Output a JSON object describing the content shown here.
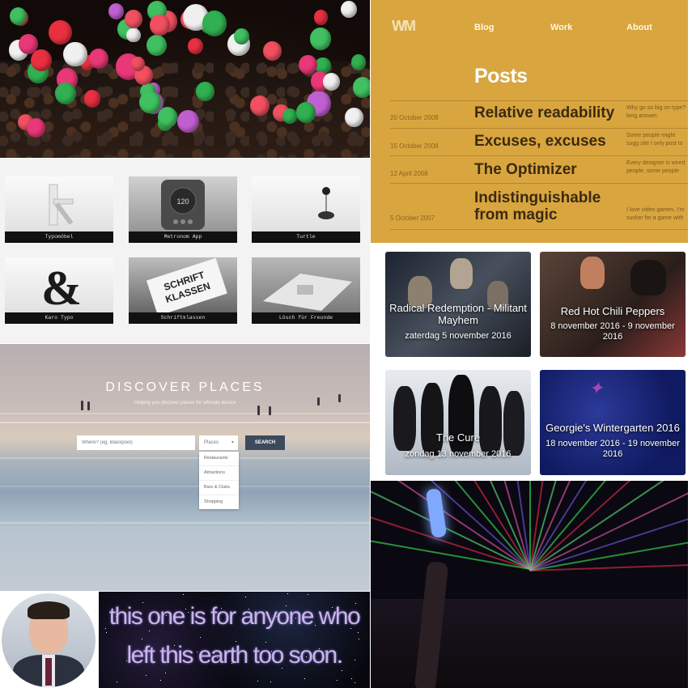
{
  "blog": {
    "nav": [
      "Blog",
      "Work",
      "About"
    ],
    "posts_title": "Posts",
    "posts": [
      {
        "date": "20 October 2008",
        "title": "Relative readability",
        "excerpt": "Why go so big on type? long answer."
      },
      {
        "date": "15 October 2008",
        "title": "Excuses, excuses",
        "excerpt": "Some people might sugg site I only post to twice"
      },
      {
        "date": "12 April 2008",
        "title": "The Optimizer",
        "excerpt": "Every designer is wired people, some people are"
      },
      {
        "date": "5 October 2007",
        "title": "Indistinguishable from magic",
        "excerpt": "I love video games. I'm sucker for a game with a"
      }
    ],
    "accent": "#d9a53f"
  },
  "products": [
    {
      "caption": "Typomöbel",
      "icon": "furniture-icon"
    },
    {
      "caption": "Metronom App",
      "icon": "metronome-icon",
      "display": "120"
    },
    {
      "caption": "Turtle",
      "icon": "turtle-balloon-icon"
    },
    {
      "caption": "Karo Typo",
      "icon": "ampersand-icon"
    },
    {
      "caption": "Schriftklassen",
      "icon": "card-icon",
      "card_text": "SCHRIFT KLASSEN"
    },
    {
      "caption": "Lösch für Freunde",
      "icon": "book-icon"
    }
  ],
  "events": [
    {
      "title": "Radical Redemption - Militant Mayhem",
      "date": "zaterdag 5 november 2016"
    },
    {
      "title": "Red Hot Chili Peppers",
      "date": "8 november 2016 - 9 november 2016"
    },
    {
      "title": "The Cure",
      "date": "zondag 13 november 2016"
    },
    {
      "title": "Georgie's Wintergarten 2016",
      "date": "18 november 2016 - 19 november 2016"
    }
  ],
  "discover": {
    "heading": "DISCOVER PLACES",
    "subheading": "Helping you discover places for ultimate leisure",
    "search_placeholder": "Where? (eg. Blackpool)",
    "select_value": "Places",
    "search_button": "SEARCH",
    "options": [
      "Restaurants",
      "Attractions",
      "Bars & Clubs",
      "Shopping"
    ]
  },
  "quote": {
    "line1": "this one is for anyone who",
    "line2": "left this earth too soon."
  }
}
